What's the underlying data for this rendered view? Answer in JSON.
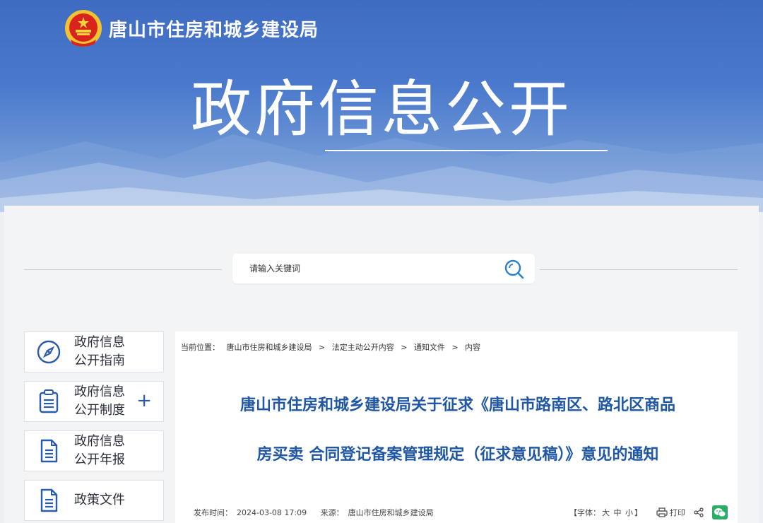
{
  "header": {
    "site_name": "唐山市住房和城乡建设局",
    "banner_title": "政府信息公开"
  },
  "search": {
    "placeholder": "请输入关键词"
  },
  "sidebar": {
    "items": [
      {
        "line1": "政府信息",
        "line2": "公开指南",
        "icon": "compass-icon"
      },
      {
        "line1": "政府信息",
        "line2": "公开制度",
        "icon": "clipboard-list-icon",
        "expand": "+"
      },
      {
        "line1": "政府信息",
        "line2": "公开年报",
        "icon": "document-icon"
      },
      {
        "line1": "政策文件",
        "icon": "document-icon"
      }
    ]
  },
  "breadcrumb": {
    "prefix": "当前位置：",
    "items": [
      "唐山市住房和城乡建设局",
      "法定主动公开内容",
      "通知文件",
      "内容"
    ],
    "separator": ">"
  },
  "article": {
    "title_line1": "唐山市住房和城乡建设局关于征求《唐山市路南区、路北区商品",
    "title_line2": "房买卖 合同登记备案管理规定（征求意见稿）》意见的通知",
    "publish_label": "发布时间：",
    "publish_time": "2024-03-08 17:09",
    "source_label": "来源：",
    "source": "唐山市住房和城乡建设局"
  },
  "tools": {
    "font_open": "【字体：",
    "font_large": "大",
    "font_medium": "中",
    "font_small": "小",
    "font_close": "】",
    "print_label": "打印"
  },
  "colors": {
    "banner_blue": "#3f6cc2",
    "title_blue": "#1f57a4",
    "accent_blue": "#2b5aa8",
    "wechat_green": "#2aae67"
  }
}
